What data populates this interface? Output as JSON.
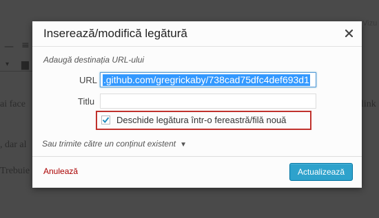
{
  "background": {
    "vizual_tab": "Vizu",
    "lines_left": [
      "ai face",
      ", dar al",
      "Trebuie"
    ],
    "lines_right": [
      "link"
    ]
  },
  "dialog": {
    "title": "Inserează/modifică legătură",
    "hint": "Adaugă destinația URL-ului",
    "url_label": "URL",
    "url_value": ".github.com/gregrickaby/738cad75dfc4def693d1",
    "title_label": "Titlu",
    "title_value": "",
    "new_tab_label": "Deschide legătura într-o fereastră/filă nouă",
    "new_tab_checked": true,
    "search_toggle": "Sau trimite către un conținut existent",
    "cancel_label": "Anulează",
    "update_label": "Actualizează"
  },
  "colors": {
    "accent": "#2ea2cc",
    "highlight_border": "#c0312c",
    "cancel": "#aa0000"
  }
}
